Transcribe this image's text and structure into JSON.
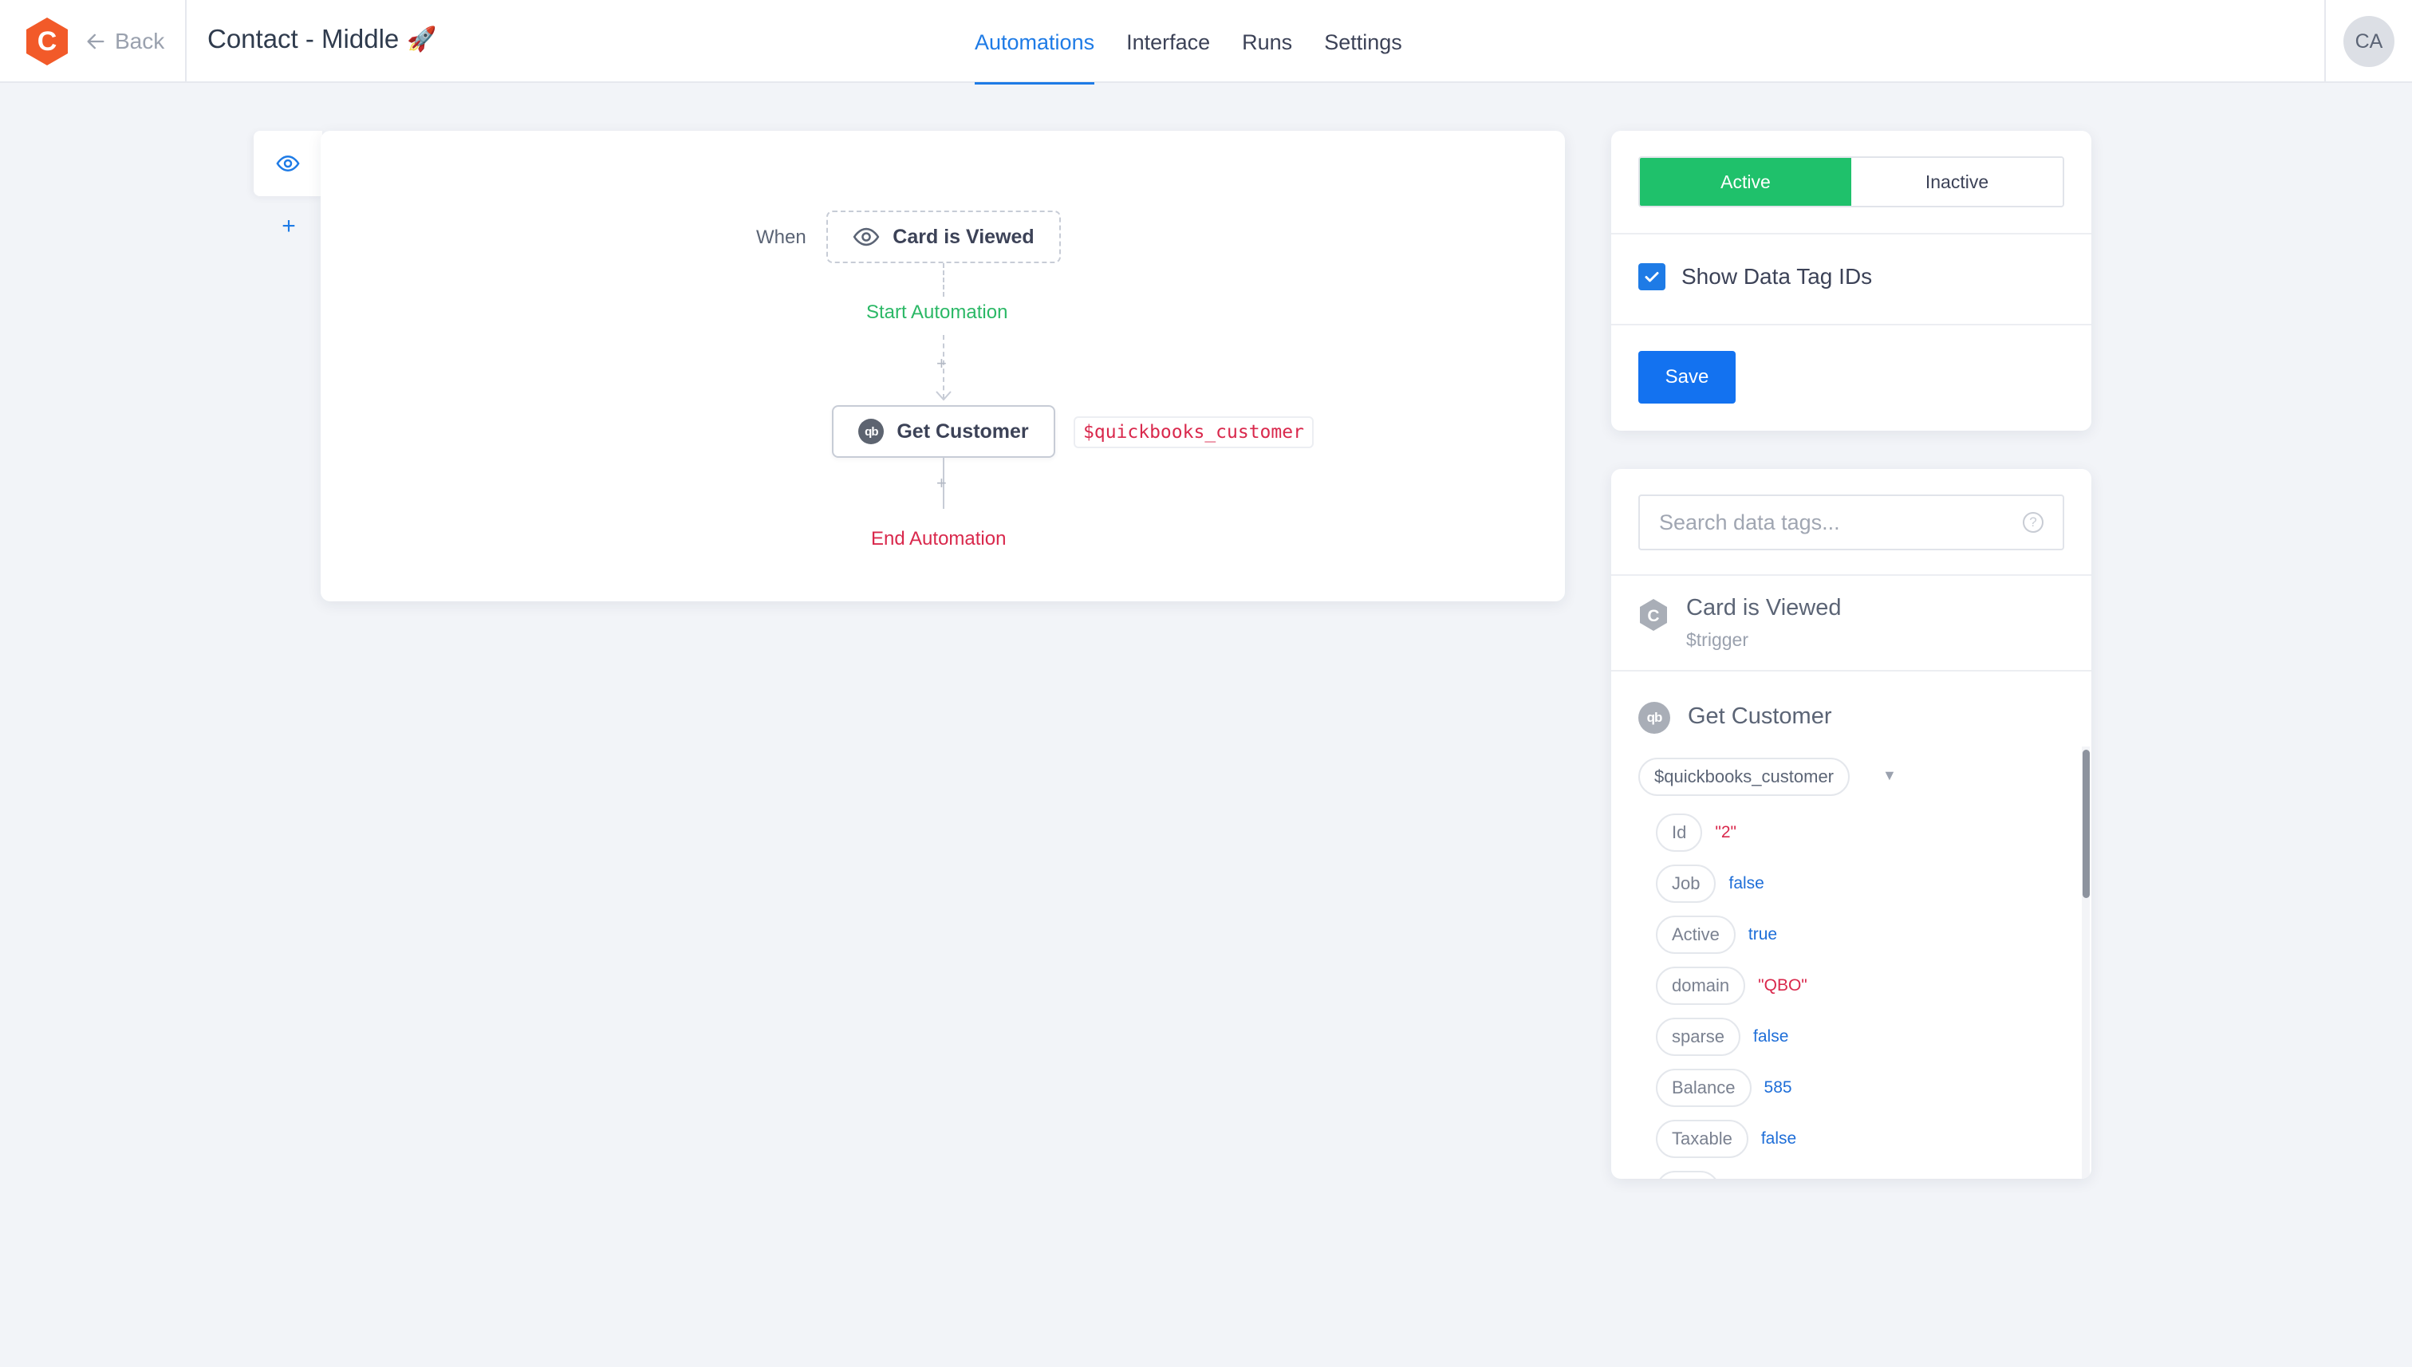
{
  "header": {
    "back_label": "Back",
    "title": "Contact - Middle",
    "title_emoji": "🚀",
    "tabs": [
      "Automations",
      "Interface",
      "Runs",
      "Settings"
    ],
    "active_tab": "Automations",
    "avatar_initials": "CA",
    "brand_color": "#f25a29"
  },
  "rail": {
    "trigger_icon": "eye-icon",
    "add_label": "+"
  },
  "canvas": {
    "when_label": "When",
    "trigger_label": "Card is Viewed",
    "start_label": "Start Automation",
    "action_label": "Get Customer",
    "action_icon_text": "qb",
    "action_output_tag": "$quickbooks_customer",
    "end_label": "End Automation"
  },
  "status_panel": {
    "active_label": "Active",
    "inactive_label": "Inactive",
    "selected": "Active",
    "show_ids_label": "Show Data Tag IDs",
    "show_ids_checked": true,
    "save_label": "Save",
    "active_color": "#1fc16b",
    "save_color": "#1372f0"
  },
  "tags_panel": {
    "search_placeholder": "Search data tags...",
    "help_glyph": "?",
    "groups": [
      {
        "title": "Card is Viewed",
        "subtitle": "$trigger",
        "icon": "hexagon-c-icon"
      },
      {
        "title": "Get Customer",
        "icon": "quickbooks-icon",
        "icon_text": "qb"
      }
    ],
    "root_tag": "$quickbooks_customer",
    "caret": "▼",
    "fields": [
      {
        "key": "Id",
        "value": "\"2\"",
        "type": "str"
      },
      {
        "key": "Job",
        "value": "false",
        "type": "bool"
      },
      {
        "key": "Active",
        "value": "true",
        "type": "bool"
      },
      {
        "key": "domain",
        "value": "\"QBO\"",
        "type": "str"
      },
      {
        "key": "sparse",
        "value": "false",
        "type": "bool"
      },
      {
        "key": "Balance",
        "value": "585",
        "type": "num"
      },
      {
        "key": "Taxable",
        "value": "false",
        "type": "bool"
      }
    ]
  }
}
